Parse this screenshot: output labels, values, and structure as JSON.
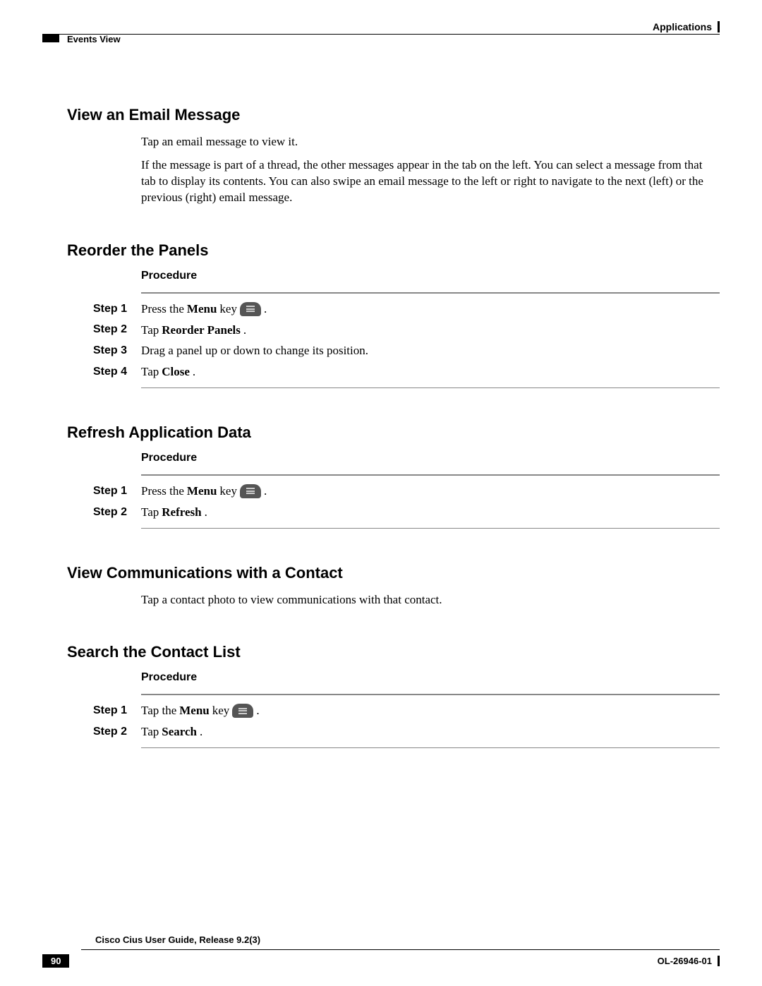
{
  "header": {
    "chapter": "Applications",
    "section": "Events View"
  },
  "sections": {
    "viewEmail": {
      "title": "View an Email Message",
      "p1": "Tap an email message to view it.",
      "p2": "If the message is part of a thread, the other messages appear in the tab on the left. You can select a message from that tab to display its contents. You can also swipe an email message to the left or right to navigate to the next (left) or the previous (right) email message."
    },
    "reorderPanels": {
      "title": "Reorder the Panels",
      "procedureLabel": "Procedure",
      "steps": {
        "s1": {
          "label": "Step 1",
          "pre": "Press the ",
          "bold": "Menu",
          "post": " key",
          "period": "."
        },
        "s2": {
          "label": "Step 2",
          "pre": "Tap ",
          "bold": "Reorder Panels",
          "post": "."
        },
        "s3": {
          "label": "Step 3",
          "text": "Drag a panel up or down to change its position."
        },
        "s4": {
          "label": "Step 4",
          "pre": "Tap ",
          "bold": "Close",
          "post": "."
        }
      }
    },
    "refreshData": {
      "title": "Refresh Application Data",
      "procedureLabel": "Procedure",
      "steps": {
        "s1": {
          "label": "Step 1",
          "pre": "Press the ",
          "bold": "Menu",
          "post": " key",
          "period": "."
        },
        "s2": {
          "label": "Step 2",
          "pre": "Tap ",
          "bold": "Refresh",
          "post": "."
        }
      }
    },
    "viewComms": {
      "title": "View Communications with a Contact",
      "p1": "Tap a contact photo to view communications with that contact."
    },
    "searchContact": {
      "title": "Search the Contact List",
      "procedureLabel": "Procedure",
      "steps": {
        "s1": {
          "label": "Step 1",
          "pre": "Tap the ",
          "bold": "Menu",
          "post": " key",
          "period": "."
        },
        "s2": {
          "label": "Step 2",
          "pre": "Tap ",
          "bold": "Search",
          "post": "."
        }
      }
    }
  },
  "footer": {
    "guideTitle": "Cisco Cius User Guide, Release 9.2(3)",
    "pageNumber": "90",
    "docId": "OL-26946-01"
  }
}
